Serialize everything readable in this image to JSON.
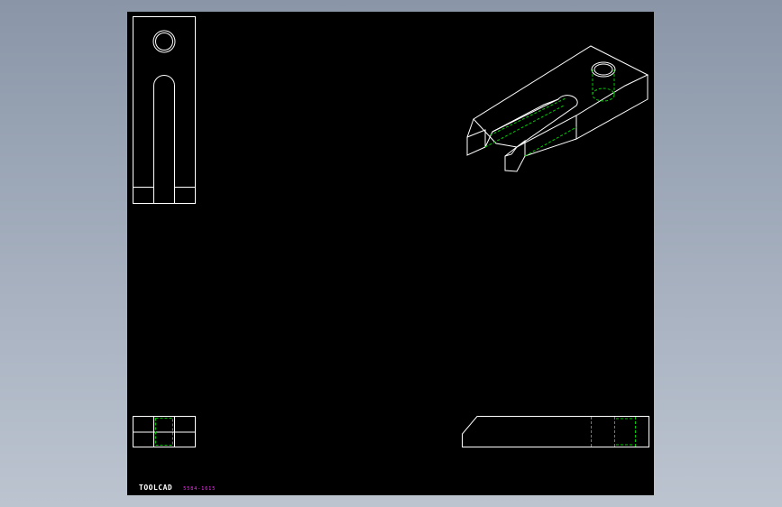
{
  "drawing": {
    "background_color": "#000000",
    "line_color": "#ffffff",
    "hidden_line_color": "#00cc00",
    "annotation_color": "#ff33ff",
    "views": [
      "top-view",
      "isometric-view",
      "front-view",
      "side-view"
    ]
  },
  "title_block": {
    "logo_text": "TOOLCAD",
    "part_code": "5584-1615"
  }
}
